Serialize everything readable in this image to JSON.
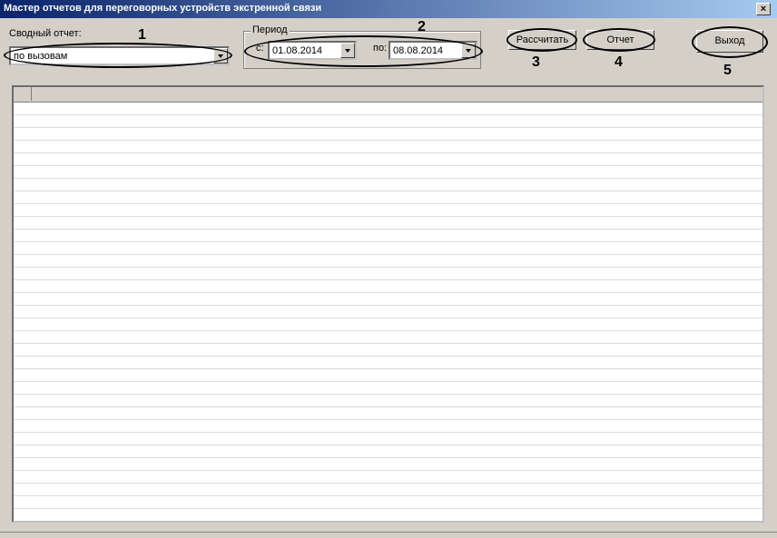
{
  "window": {
    "title": "Мастер отчетов для переговорных устройств экстренной связи",
    "close_glyph": "×"
  },
  "summary": {
    "label": "Сводный отчет:",
    "value": "по вызовам"
  },
  "period": {
    "title": "Период",
    "from_label": "с:",
    "from_value": "01.08.2014",
    "to_label": "по:",
    "to_value": "08.08.2014"
  },
  "buttons": {
    "calculate": "Рассчитать",
    "report": "Отчет",
    "exit": "Выход"
  },
  "annotations": [
    "1",
    "2",
    "3",
    "4",
    "5"
  ]
}
